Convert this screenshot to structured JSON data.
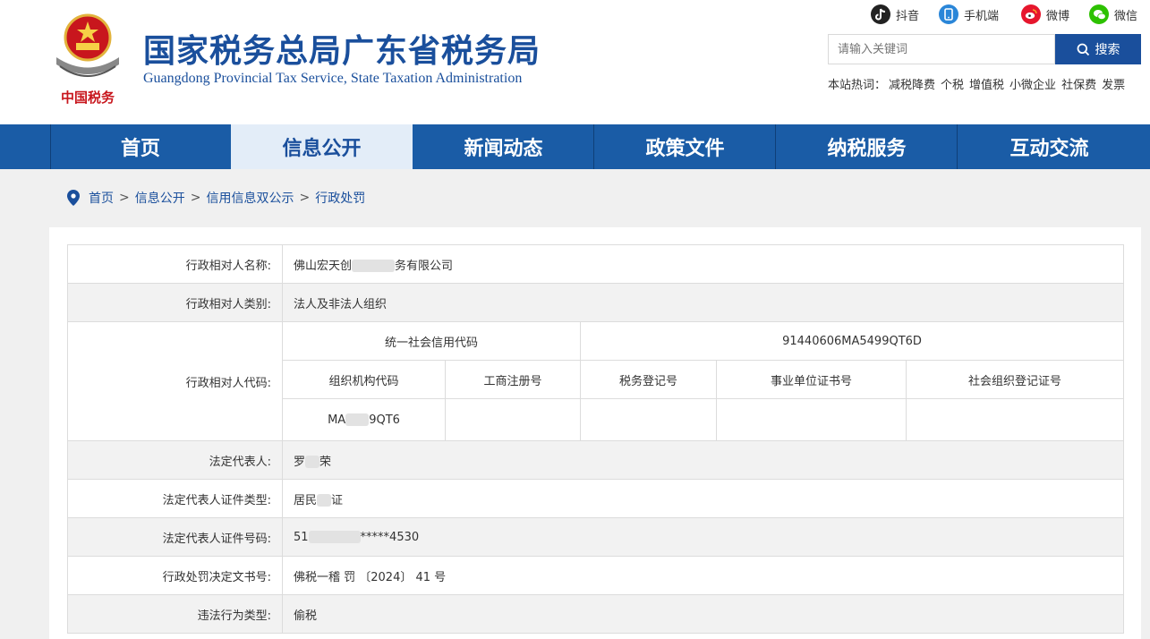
{
  "header": {
    "title_cn": "国家税务总局广东省税务局",
    "title_en": "Guangdong Provincial Tax Service, State Taxation Administration",
    "emblem_text": "中国税务"
  },
  "social": [
    {
      "label": "抖音",
      "icon": "douyin-icon"
    },
    {
      "label": "手机端",
      "icon": "mobile-icon"
    },
    {
      "label": "微博",
      "icon": "weibo-icon"
    },
    {
      "label": "微信",
      "icon": "wechat-icon"
    }
  ],
  "search": {
    "placeholder": "请输入关键词",
    "button_label": "搜索"
  },
  "hot": {
    "label": "本站热词：",
    "items": [
      "减税降费",
      "个税",
      "增值税",
      "小微企业",
      "社保费",
      "发票"
    ]
  },
  "nav": {
    "items": [
      "首页",
      "信息公开",
      "新闻动态",
      "政策文件",
      "纳税服务",
      "互动交流"
    ],
    "active": "信息公开"
  },
  "breadcrumb": [
    "首页",
    "信息公开",
    "信用信息双公示",
    "行政处罚"
  ],
  "record": {
    "name_label": "行政相对人名称:",
    "name_a": "佛山宏天创",
    "name_b": "务有限公司",
    "category_label": "行政相对人类别:",
    "category": "法人及非法人组织",
    "code_label": "行政相对人代码:",
    "usc_header": "统一社会信用代码",
    "usc_value": "91440606MA5499QT6D",
    "sub_headers": [
      "组织机构代码",
      "工商注册号",
      "税务登记号",
      "事业单位证书号",
      "社会组织登记证号"
    ],
    "org_code_a": "MA",
    "org_code_b": "9QT6",
    "legal_rep_label": "法定代表人:",
    "legal_rep_a": "罗",
    "legal_rep_b": "荣",
    "id_type_label": "法定代表人证件类型:",
    "id_type_a": "居民",
    "id_type_b": "证",
    "id_no_label": "法定代表人证件号码:",
    "id_no_a": "51",
    "id_no_b": "*****4530",
    "decision_label": "行政处罚决定文书号:",
    "decision": "佛税一稽 罚 〔2024〕 41 号",
    "violation_label": "违法行为类型:",
    "violation": "偷税"
  },
  "colors": {
    "brand_blue": "#1a4f9c",
    "nav_blue": "#1a5ca6",
    "nav_active_bg": "#e3edf8",
    "emblem_red": "#c8161d"
  }
}
